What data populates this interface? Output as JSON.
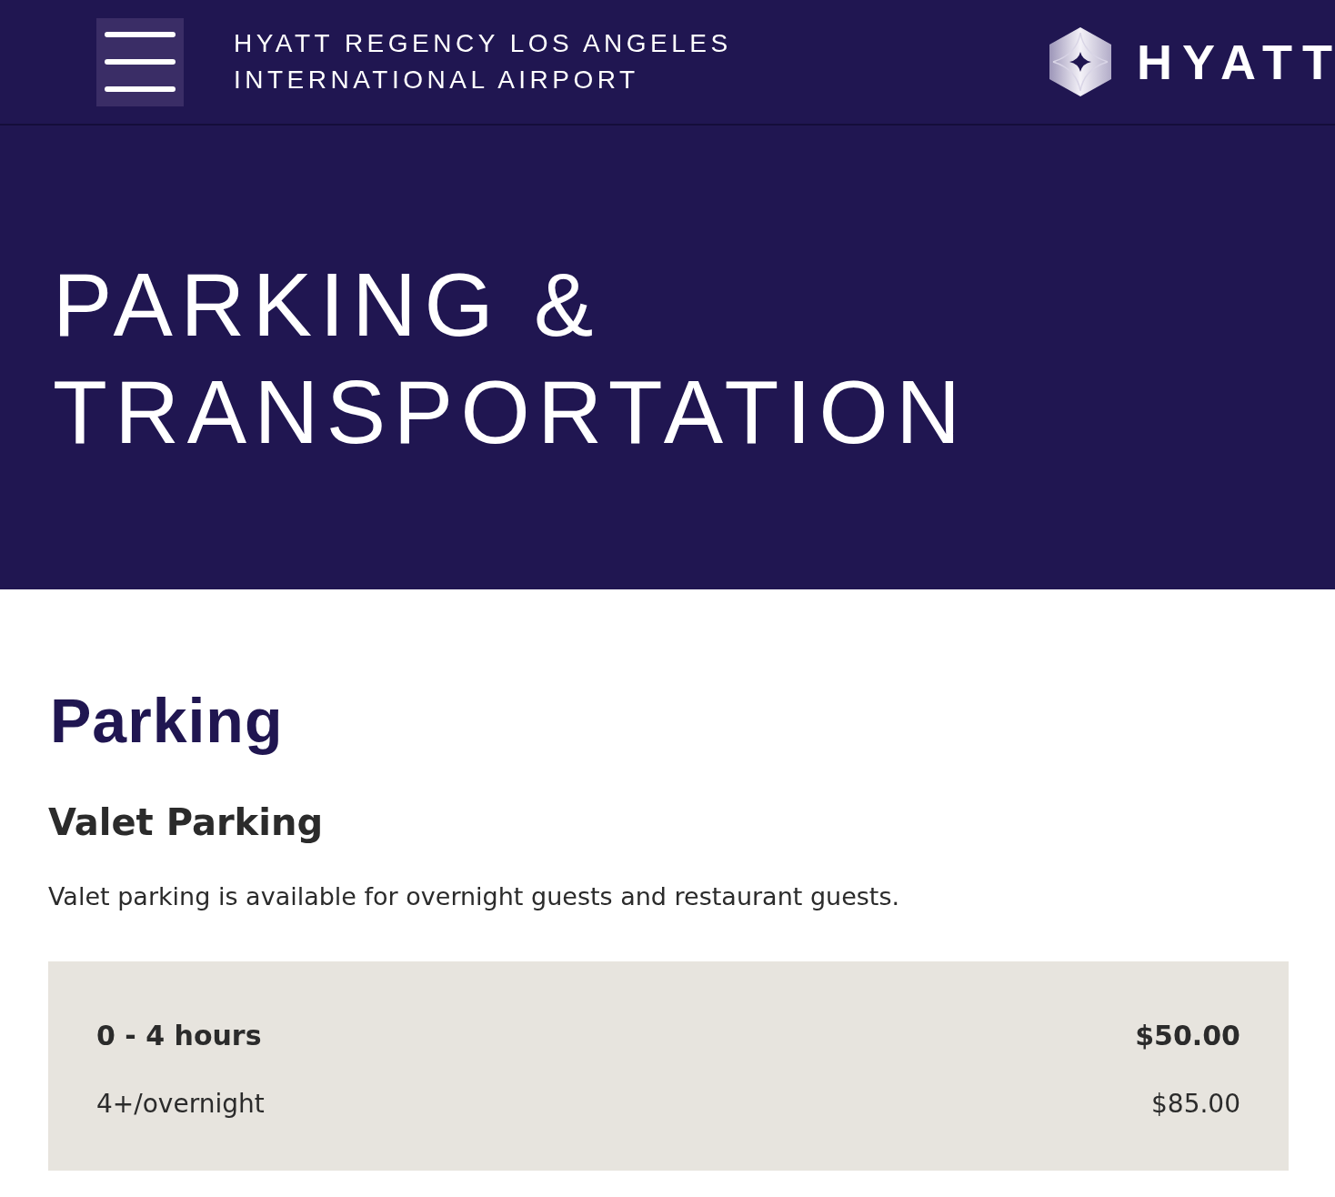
{
  "header": {
    "hotel_name": "HYATT REGENCY LOS ANGELES INTERNATIONAL AIRPORT",
    "logo_text": "HYATT"
  },
  "hero": {
    "title": "PARKING & TRANSPORTATION"
  },
  "section": {
    "title": "Parking",
    "subsections": [
      {
        "title": "Valet Parking",
        "description": "Valet parking is available for overnight guests and restaurant guests.",
        "rates": [
          {
            "label": "0 - 4 hours",
            "price": "$50.00",
            "highlighted": true
          },
          {
            "label": "4+/overnight",
            "price": "$85.00",
            "highlighted": false
          }
        ]
      }
    ]
  }
}
